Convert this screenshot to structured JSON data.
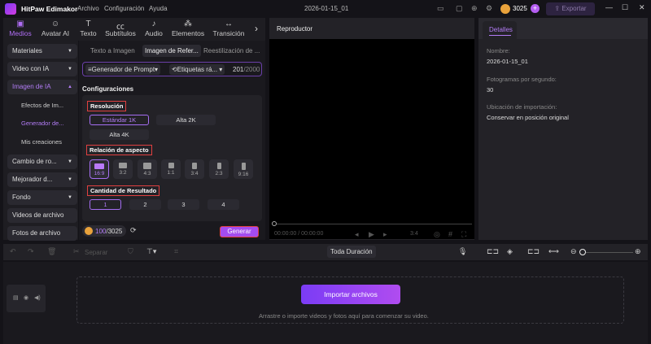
{
  "titlebar": {
    "app_name": "HitPaw Edimakor",
    "menu": [
      "Archivo",
      "Configuración",
      "Ayuda"
    ],
    "project": "2026-01-15_01",
    "credits": "3025",
    "export": "Exportar"
  },
  "tabs": [
    {
      "label": "Medios",
      "icon": "media-icon"
    },
    {
      "label": "Avatar AI",
      "icon": "avatar-icon"
    },
    {
      "label": "Texto",
      "icon": "text-icon"
    },
    {
      "label": "Subtítulos",
      "icon": "subtitles-icon"
    },
    {
      "label": "Audio",
      "icon": "audio-icon"
    },
    {
      "label": "Elementos",
      "icon": "elements-icon"
    },
    {
      "label": "Transición",
      "icon": "transition-icon"
    }
  ],
  "sidebar": {
    "items": [
      "Materiales",
      "Video con IA",
      "Imagen de IA",
      "Cambio de ro...",
      "Mejorador d...",
      "Fondo",
      "Videos de archivo",
      "Fotos de archivo"
    ],
    "sub": [
      "Efectos de Im...",
      "Generador de...",
      "Mis creaciones"
    ]
  },
  "content": {
    "subtabs": [
      "Texto a Imagen",
      "Imagen de Refer...",
      "Reestilización de ..."
    ],
    "prompt_gen": "Generador de Prompt",
    "tags": "Etiquetas rá...",
    "char_count": "201",
    "char_max": "/2000",
    "config": "Configuraciones",
    "res_title": "Resolución",
    "res": [
      "Estándar 1K",
      "Alta 2K",
      "Alta 4K"
    ],
    "aspect_title": "Relación de aspecto",
    "aspects": [
      "16:9",
      "3:2",
      "4:3",
      "1:1",
      "3:4",
      "2:3",
      "9:16"
    ],
    "count_title": "Cantidad de Resultado",
    "counts": [
      "1",
      "2",
      "3",
      "4"
    ],
    "credits_used": "100",
    "credits_total": "/3025",
    "generate": "Generar"
  },
  "player": {
    "title": "Reproductor",
    "time": "00:00:00 / 00:00:00",
    "ratio": "3:4"
  },
  "details": {
    "tab": "Detalles",
    "name_label": "Nombre:",
    "name": "2026-01-15_01",
    "fps_label": "Fotogramas por segundo:",
    "fps": "30",
    "loc_label": "Ubicación de importación:",
    "loc": "Conservar en posición original"
  },
  "timeline": {
    "split": "Separar",
    "duration": "Toda Duración",
    "import": "Importar archivos",
    "hint": "Arrastre o importe videos y fotos aquí para comenzar su video."
  }
}
